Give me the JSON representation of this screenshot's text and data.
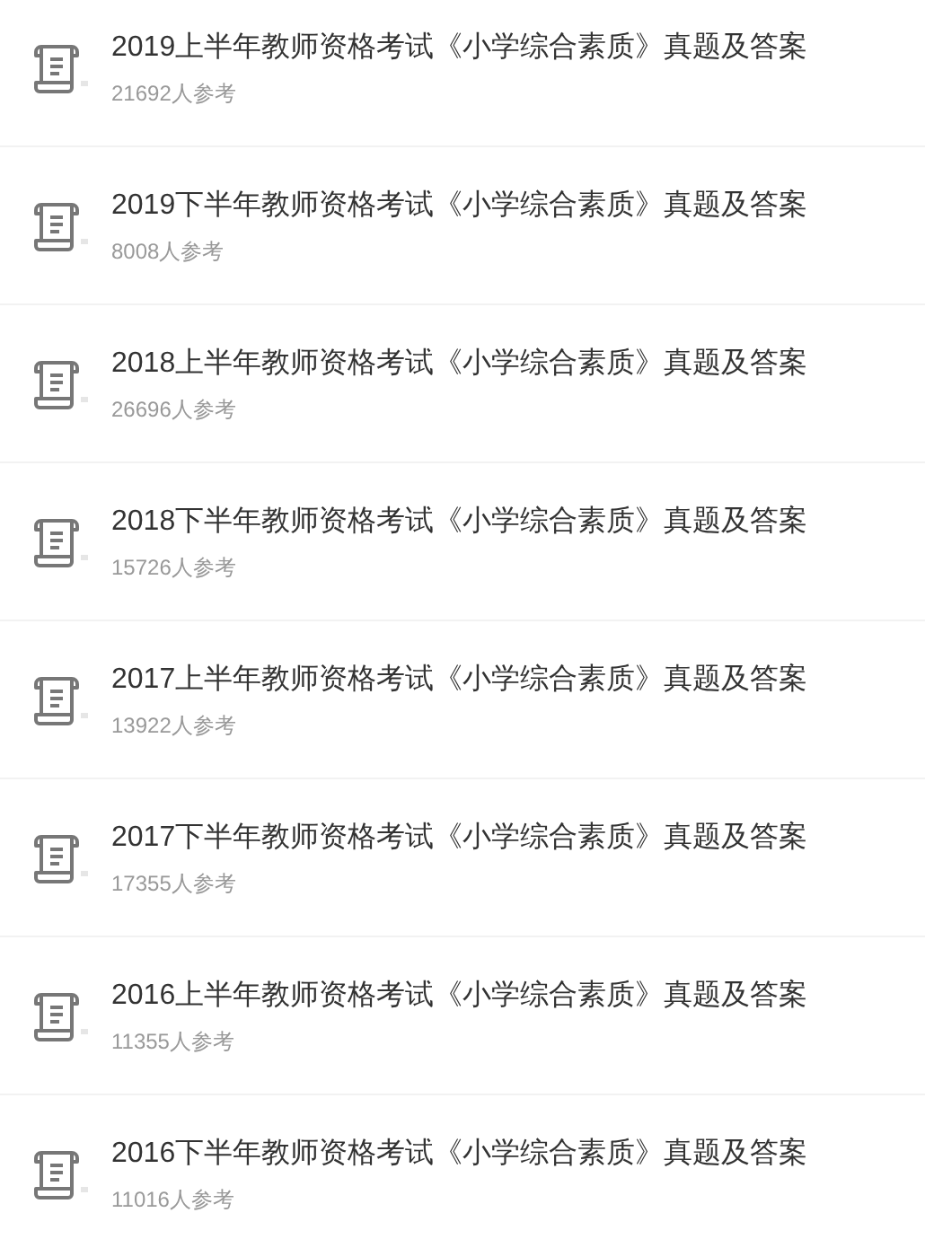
{
  "items": [
    {
      "title": "2019上半年教师资格考试《小学综合素质》真题及答案",
      "count": "21692人参考"
    },
    {
      "title": "2019下半年教师资格考试《小学综合素质》真题及答案",
      "count": "8008人参考"
    },
    {
      "title": "2018上半年教师资格考试《小学综合素质》真题及答案",
      "count": "26696人参考"
    },
    {
      "title": "2018下半年教师资格考试《小学综合素质》真题及答案",
      "count": "15726人参考"
    },
    {
      "title": "2017上半年教师资格考试《小学综合素质》真题及答案",
      "count": "13922人参考"
    },
    {
      "title": "2017下半年教师资格考试《小学综合素质》真题及答案",
      "count": "17355人参考"
    },
    {
      "title": "2016上半年教师资格考试《小学综合素质》真题及答案",
      "count": "11355人参考"
    },
    {
      "title": "2016下半年教师资格考试《小学综合素质》真题及答案",
      "count": "11016人参考"
    }
  ]
}
